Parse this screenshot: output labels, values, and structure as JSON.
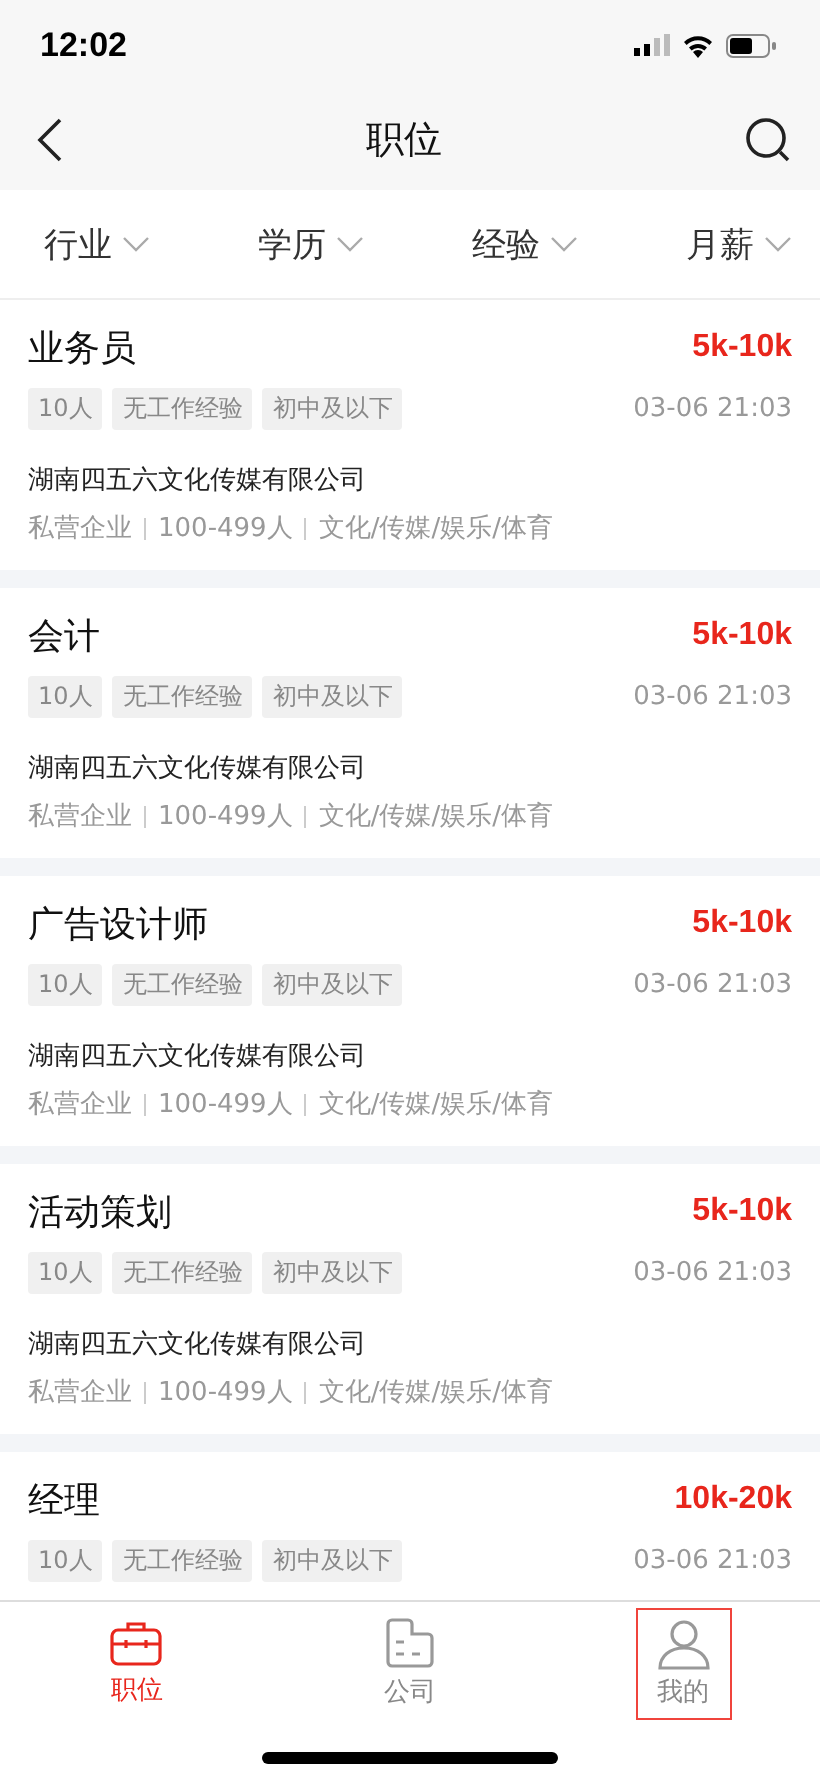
{
  "status_bar": {
    "time": "12:02"
  },
  "header": {
    "title": "职位"
  },
  "filters": [
    {
      "label": "行业"
    },
    {
      "label": "学历"
    },
    {
      "label": "经验"
    },
    {
      "label": "月薪"
    }
  ],
  "jobs": [
    {
      "title": "业务员",
      "salary": "5k-10k",
      "tags": [
        "10人",
        "无工作经验",
        "初中及以下"
      ],
      "time": "03-06 21:03",
      "company": "湖南四五六文化传媒有限公司",
      "meta": [
        "私营企业",
        "100-499人",
        "文化/传媒/娱乐/体育"
      ]
    },
    {
      "title": "会计",
      "salary": "5k-10k",
      "tags": [
        "10人",
        "无工作经验",
        "初中及以下"
      ],
      "time": "03-06 21:03",
      "company": "湖南四五六文化传媒有限公司",
      "meta": [
        "私营企业",
        "100-499人",
        "文化/传媒/娱乐/体育"
      ]
    },
    {
      "title": "广告设计师",
      "salary": "5k-10k",
      "tags": [
        "10人",
        "无工作经验",
        "初中及以下"
      ],
      "time": "03-06 21:03",
      "company": "湖南四五六文化传媒有限公司",
      "meta": [
        "私营企业",
        "100-499人",
        "文化/传媒/娱乐/体育"
      ]
    },
    {
      "title": "活动策划",
      "salary": "5k-10k",
      "tags": [
        "10人",
        "无工作经验",
        "初中及以下"
      ],
      "time": "03-06 21:03",
      "company": "湖南四五六文化传媒有限公司",
      "meta": [
        "私营企业",
        "100-499人",
        "文化/传媒/娱乐/体育"
      ]
    },
    {
      "title": "经理",
      "salary": "10k-20k",
      "tags": [
        "10人",
        "无工作经验",
        "初中及以下"
      ],
      "time": "03-06 21:03"
    }
  ],
  "tabs": [
    {
      "kind": "jobs",
      "label": "职位",
      "selected": true,
      "outlined": false
    },
    {
      "kind": "company",
      "label": "公司",
      "selected": false,
      "outlined": false
    },
    {
      "kind": "me",
      "label": "我的",
      "selected": false,
      "outlined": true
    }
  ]
}
